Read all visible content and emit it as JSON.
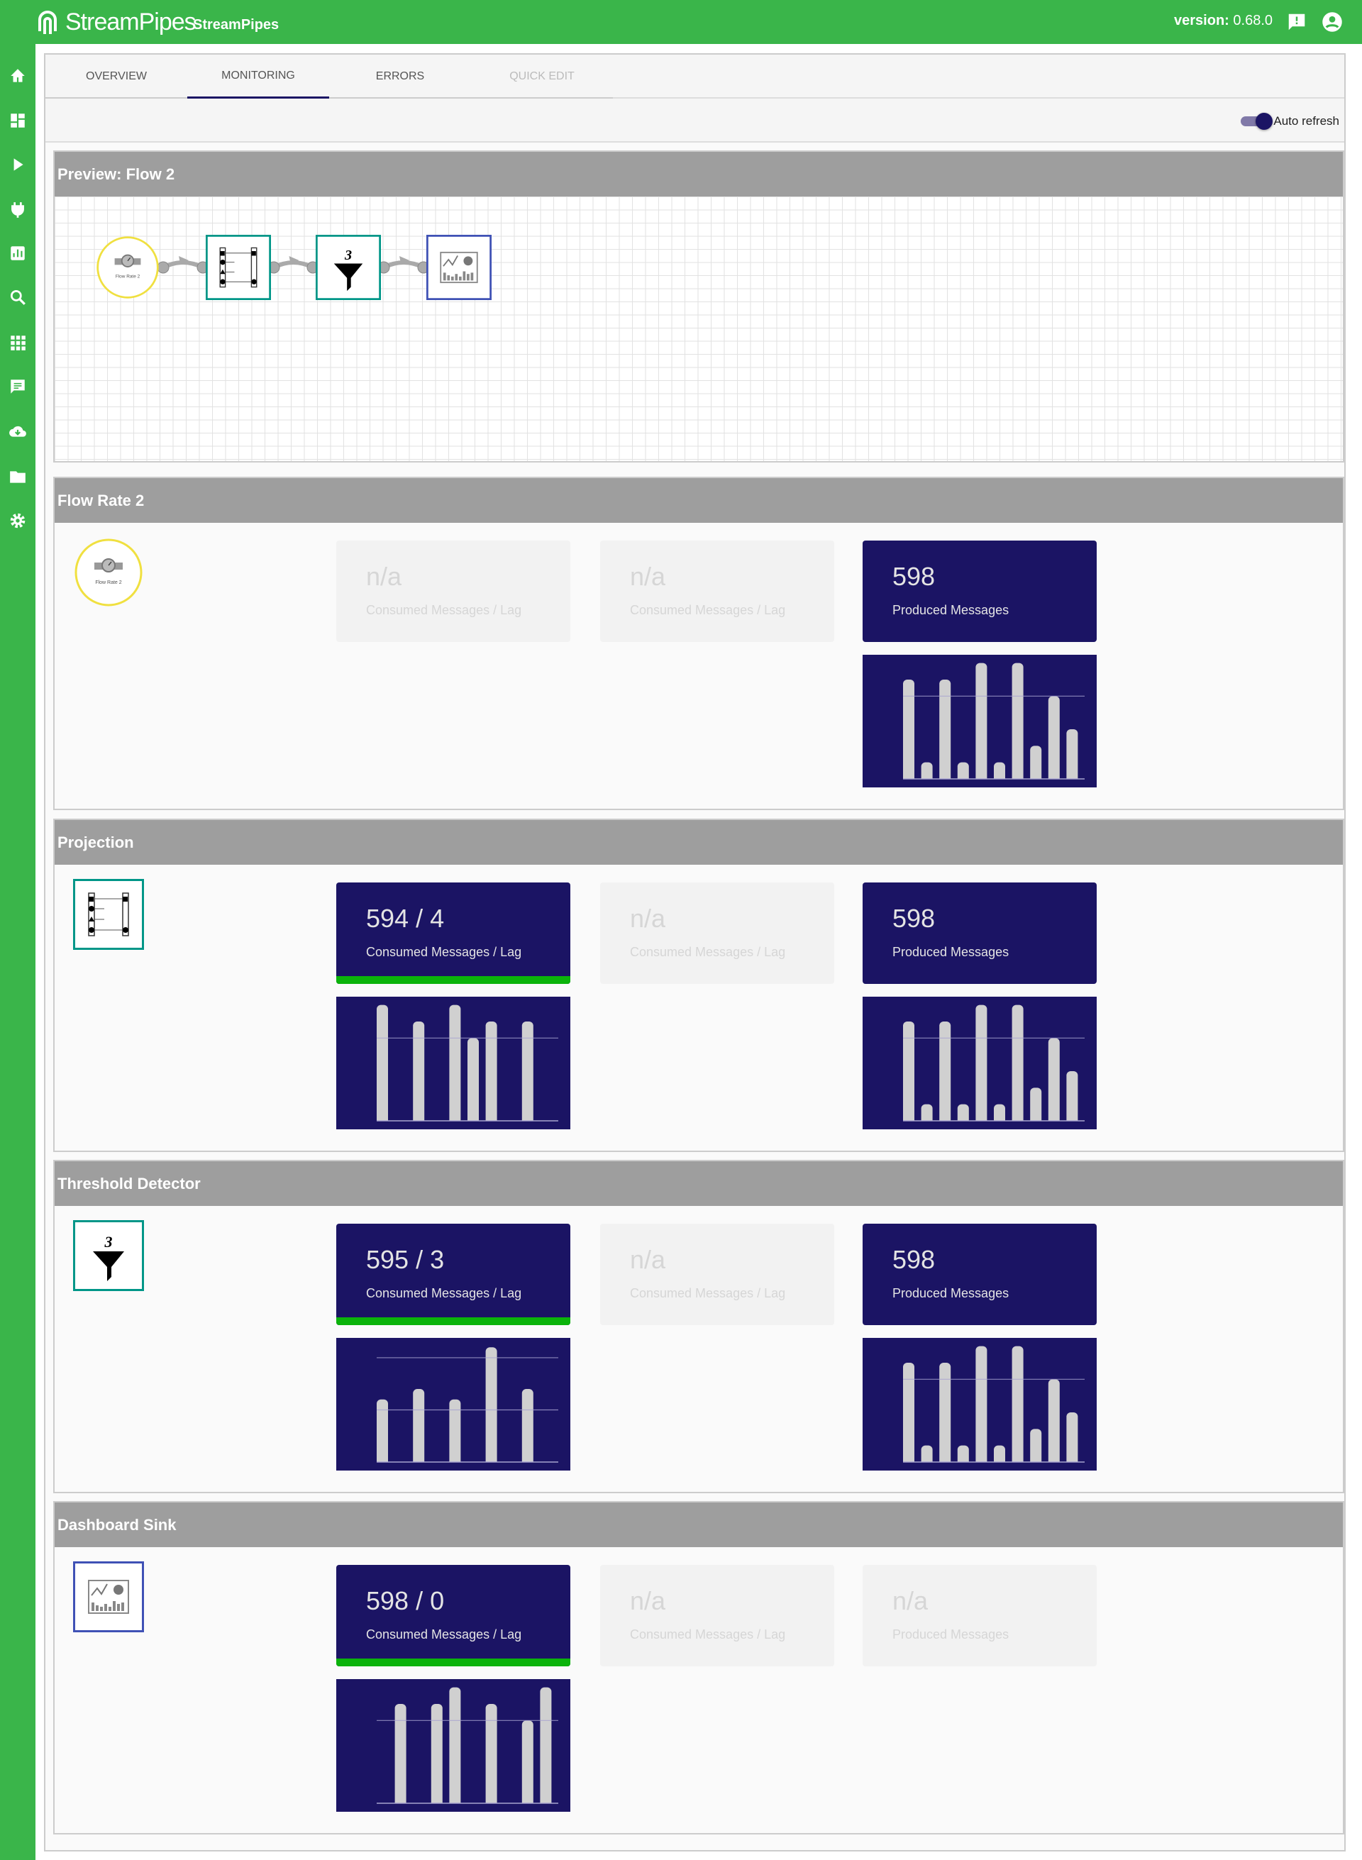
{
  "header": {
    "logo_text": "StreamPipes",
    "app_name": "StreamPipes",
    "version_label": "version:",
    "version_value": "0.68.0",
    "icons": [
      "feedback-icon",
      "account-icon"
    ],
    "color": "#3ab54a"
  },
  "sidebar": {
    "icons": [
      "home-icon",
      "dashboard-icon",
      "play-icon",
      "plug-icon",
      "chart-icon",
      "search-icon",
      "apps-icon",
      "message-icon",
      "cloud-download-icon",
      "folder-icon",
      "gear-icon"
    ]
  },
  "tabs": [
    {
      "label": "OVERVIEW",
      "state": "normal"
    },
    {
      "label": "MONITORING",
      "state": "active"
    },
    {
      "label": "ERRORS",
      "state": "normal"
    },
    {
      "label": "QUICK EDIT",
      "state": "disabled"
    }
  ],
  "toolbar": {
    "auto_refresh_label": "Auto refresh",
    "auto_refresh_on": true
  },
  "preview": {
    "title": "Preview: Flow 2",
    "nodes": [
      {
        "type": "stream",
        "icon": "flow-gauge-icon",
        "label": "Flow Rate 2",
        "border": "#f0e040"
      },
      {
        "type": "processor",
        "icon": "projection-icon",
        "border": "#009688"
      },
      {
        "type": "processor",
        "icon": "funnel-icon",
        "badge": "3",
        "border": "#009688"
      },
      {
        "type": "sink",
        "icon": "dashboard-sink-icon",
        "border": "#3f51b5"
      }
    ]
  },
  "colors": {
    "card_active": "#1b1464",
    "card_inactive": "#f2f2f2",
    "lag_ok": "#0bb30b",
    "bar": "#d0d0d0"
  },
  "sections": [
    {
      "title": "Flow Rate 2",
      "icon": "flow-gauge-icon",
      "icon_label": "Flow Rate 2",
      "cards": [
        {
          "value": "n/a",
          "label": "Consumed Messages / Lag",
          "active": false,
          "lag_ok": false
        },
        {
          "value": "n/a",
          "label": "Consumed Messages / Lag",
          "active": false,
          "lag_ok": false
        },
        {
          "value": "598",
          "label": "Produced Messages",
          "active": true,
          "lag_ok": false
        }
      ],
      "charts": [
        null,
        null,
        {
          "type": "bar",
          "slots": 10,
          "x": [
            0,
            1,
            2,
            3,
            4,
            5,
            6,
            7,
            8,
            9
          ],
          "values": [
            6,
            1,
            6,
            1,
            7,
            1,
            7,
            2,
            5,
            3
          ],
          "ylim": [
            0,
            7.5
          ],
          "gridlines": [
            5
          ]
        }
      ]
    },
    {
      "title": "Projection",
      "icon": "projection-icon",
      "cards": [
        {
          "value": "594 / 4",
          "label": "Consumed Messages / Lag",
          "active": true,
          "lag_ok": true
        },
        {
          "value": "n/a",
          "label": "Consumed Messages / Lag",
          "active": false,
          "lag_ok": false
        },
        {
          "value": "598",
          "label": "Produced Messages",
          "active": true,
          "lag_ok": false
        }
      ],
      "charts": [
        {
          "type": "bar",
          "slots": 10,
          "x": [
            0,
            2,
            4,
            5,
            6,
            8
          ],
          "values": [
            7,
            6,
            7,
            5,
            6,
            6
          ],
          "ylim": [
            0,
            7.5
          ],
          "gridlines": [
            5
          ]
        },
        null,
        {
          "type": "bar",
          "slots": 10,
          "x": [
            0,
            1,
            2,
            3,
            4,
            5,
            6,
            7,
            8,
            9
          ],
          "values": [
            6,
            1,
            6,
            1,
            7,
            1,
            7,
            2,
            5,
            3
          ],
          "ylim": [
            0,
            7.5
          ],
          "gridlines": [
            5
          ]
        }
      ]
    },
    {
      "title": "Threshold Detector",
      "icon": "funnel-icon",
      "icon_badge": "3",
      "cards": [
        {
          "value": "595 / 3",
          "label": "Consumed Messages / Lag",
          "active": true,
          "lag_ok": true
        },
        {
          "value": "n/a",
          "label": "Consumed Messages / Lag",
          "active": false,
          "lag_ok": false
        },
        {
          "value": "598",
          "label": "Produced Messages",
          "active": true,
          "lag_ok": false
        }
      ],
      "charts": [
        {
          "type": "bar",
          "slots": 5,
          "x": [
            0,
            1,
            2,
            3,
            4
          ],
          "values": [
            6,
            7,
            6,
            11,
            7
          ],
          "ylim": [
            0,
            11.9
          ],
          "gridlines": [
            5,
            10
          ]
        },
        null,
        {
          "type": "bar",
          "slots": 10,
          "x": [
            0,
            1,
            2,
            3,
            4,
            5,
            6,
            7,
            8,
            9
          ],
          "values": [
            6,
            1,
            6,
            1,
            7,
            1,
            7,
            2,
            5,
            3
          ],
          "ylim": [
            0,
            7.5
          ],
          "gridlines": [
            5
          ]
        }
      ]
    },
    {
      "title": "Dashboard Sink",
      "icon": "dashboard-sink-icon",
      "cards": [
        {
          "value": "598 / 0",
          "label": "Consumed Messages / Lag",
          "active": true,
          "lag_ok": true
        },
        {
          "value": "n/a",
          "label": "Consumed Messages / Lag",
          "active": false,
          "lag_ok": false
        },
        {
          "value": "n/a",
          "label": "Produced Messages",
          "active": false,
          "lag_ok": false
        }
      ],
      "charts": [
        {
          "type": "bar",
          "slots": 10,
          "x": [
            1,
            3,
            4,
            6,
            8,
            9
          ],
          "values": [
            6,
            6,
            7,
            6,
            5,
            7
          ],
          "ylim": [
            0,
            7.5
          ],
          "gridlines": [
            5
          ]
        },
        null,
        null
      ]
    }
  ]
}
